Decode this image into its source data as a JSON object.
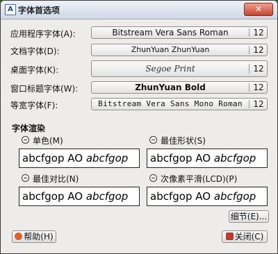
{
  "window": {
    "title": "字体首选项",
    "close": "✕"
  },
  "fonts": [
    {
      "label": "应用程序字体(A):",
      "name": "Bitstream Vera Sans Roman",
      "size": "12"
    },
    {
      "label": "文档字体(D):",
      "name": "ZhunYuan ZhunYuan",
      "size": "12"
    },
    {
      "label": "桌面字体(K):",
      "name": "Segoe Print",
      "size": "12"
    },
    {
      "label": "窗口标题字体(W):",
      "name": "ZhunYuan Bold",
      "size": "12"
    },
    {
      "label": "等宽字体(F):",
      "name": "Bitstream Vera Sans Mono Roman",
      "size": "12"
    }
  ],
  "render": {
    "title": "字体渲染",
    "options": [
      {
        "label": "单色(M)",
        "sample_plain": "abcfgop AO ",
        "sample_italic": "abcfgop"
      },
      {
        "label": "最佳形状(S)",
        "sample_plain": "abcfgop AO ",
        "sample_italic": "abcfgop"
      },
      {
        "label": "最佳对比(N)",
        "sample_plain": "abcfgop AO ",
        "sample_italic": "abcfgop"
      },
      {
        "label": "次像素平滑(LCD)(P)",
        "sample_plain": "abcfgop AO ",
        "sample_italic": "abcfgop"
      }
    ],
    "details_button": "细节(E)..."
  },
  "footer": {
    "help": "帮助(H)",
    "close": "关闭(C)"
  },
  "colors": {
    "help_icon": "#e0612a",
    "close_icon": "#c0392b"
  }
}
